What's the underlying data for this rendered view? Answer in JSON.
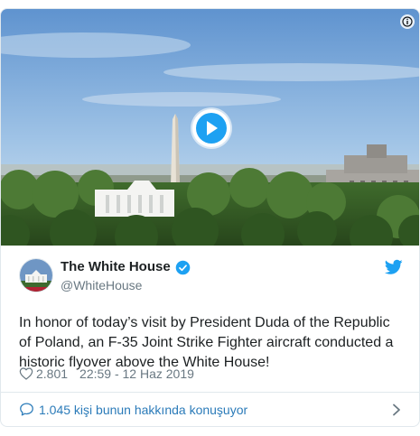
{
  "tweet": {
    "display_name": "The White House",
    "handle": "@WhiteHouse",
    "text": "In honor of today’s visit by President Duda of the Republic of Poland, an F-35 Joint Strike Fighter aircraft conducted a historic flyover above the White House!",
    "likes": "2.801",
    "timestamp": "22:59 - 12 Haz 2019",
    "conversation_link": "1.045 kişi bunun hakkında konuşuyor"
  },
  "icons": {
    "play": "play-icon",
    "info": "info-icon",
    "verified": "verified-badge-icon",
    "twitter": "twitter-bird-icon",
    "like": "heart-icon",
    "reply": "speech-bubble-icon",
    "chevron": "chevron-right-icon"
  },
  "colors": {
    "accent": "#1da1f2",
    "link": "#2b7bb9",
    "muted": "#697882",
    "text": "#1c2022",
    "border": "#e1e8ed"
  }
}
